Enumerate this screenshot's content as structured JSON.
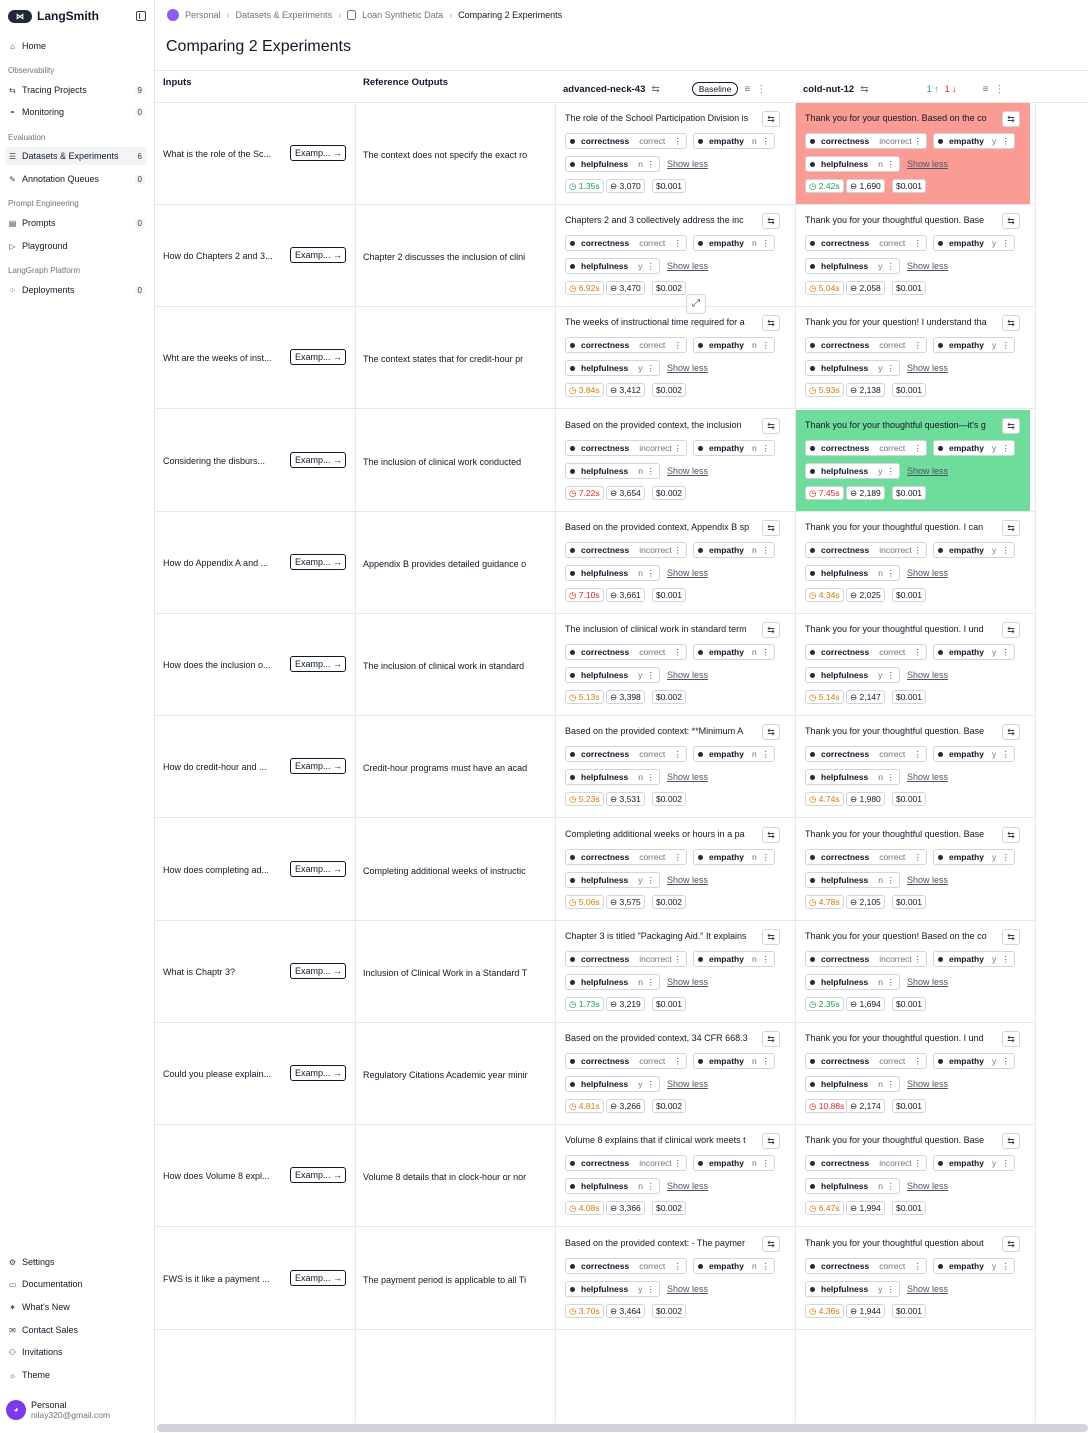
{
  "app": {
    "name": "LangSmith"
  },
  "sidebar": {
    "home": "Home",
    "sections": {
      "observability": "Observability",
      "evaluation": "Evaluation",
      "prompt_engineering": "Prompt Engineering",
      "langgraph": "LangGraph Platform"
    },
    "items": [
      {
        "label": "Tracing Projects",
        "count": "9"
      },
      {
        "label": "Monitoring",
        "count": "0"
      },
      {
        "label": "Datasets & Experiments",
        "count": "6"
      },
      {
        "label": "Annotation Queues",
        "count": "0"
      },
      {
        "label": "Prompts",
        "count": "0"
      },
      {
        "label": "Playground",
        "count": ""
      },
      {
        "label": "Deployments",
        "count": "0"
      }
    ],
    "bottom": [
      "Settings",
      "Documentation",
      "What's New",
      "Contact Sales",
      "Invitations",
      "Theme"
    ],
    "user": {
      "name": "Personal",
      "email": "nilay320@gmail.com"
    }
  },
  "breadcrumb": [
    "Personal",
    "Datasets & Experiments",
    "Loan Synthetic Data",
    "Comparing 2 Experiments"
  ],
  "page_title": "Comparing 2 Experiments",
  "columns": {
    "inputs": "Inputs",
    "reference": "Reference Outputs",
    "exp1": {
      "name": "advanced-neck-43",
      "badge": "Baseline"
    },
    "exp2": {
      "name": "cold-nut-12",
      "improved": "1",
      "regressed": "1"
    }
  },
  "example_label": "Examp...",
  "show_less": "Show less",
  "feedback_keys": {
    "correctness": "correctness",
    "empathy": "empathy",
    "helpfulness": "helpfulness"
  },
  "rows": [
    {
      "input": "What is the role of the Sc...",
      "ref": "The context does not specify the exact ro",
      "a": {
        "text": "The role of the School Participation Division is",
        "corr": "correct",
        "emp": "n",
        "help": "n",
        "lat": "1.35s",
        "latc": "g",
        "tok": "3,070",
        "cost": "$0.001"
      },
      "b": {
        "text": "Thank you for your question. Based on the co",
        "corr": "incorrect",
        "emp": "y",
        "help": "n",
        "lat": "2.42s",
        "latc": "g",
        "tok": "1,690",
        "cost": "$0.001",
        "hl": "red"
      }
    },
    {
      "input": "How do Chapters 2 and 3...",
      "ref": "Chapter 2 discusses the inclusion of clini",
      "a": {
        "text": "Chapters 2 and 3 collectively address the inc",
        "corr": "correct",
        "emp": "n",
        "help": "y",
        "lat": "6.92s",
        "latc": "o",
        "tok": "3,470",
        "cost": "$0.002"
      },
      "b": {
        "text": "Thank you for your thoughtful question. Base",
        "corr": "correct",
        "emp": "y",
        "help": "y",
        "lat": "5.04s",
        "latc": "o",
        "tok": "2,058",
        "cost": "$0.001"
      }
    },
    {
      "input": "Wht are the weeks of inst...",
      "ref": "The context states that for credit-hour pr",
      "a": {
        "text": "The weeks of instructional time required for a",
        "corr": "correct",
        "emp": "n",
        "help": "y",
        "lat": "3.84s",
        "latc": "o",
        "tok": "3,412",
        "cost": "$0.002"
      },
      "b": {
        "text": "Thank you for your question! I understand tha",
        "corr": "correct",
        "emp": "y",
        "help": "y",
        "lat": "5.93s",
        "latc": "o",
        "tok": "2,138",
        "cost": "$0.001"
      }
    },
    {
      "input": "Considering the disburs...",
      "ref": "The inclusion of clinical work conducted",
      "a": {
        "text": "Based on the provided context, the inclusion",
        "corr": "incorrect",
        "emp": "n",
        "help": "n",
        "lat": "7.22s",
        "latc": "r",
        "tok": "3,654",
        "cost": "$0.002"
      },
      "b": {
        "text": "Thank you for your thoughtful question—it's g",
        "corr": "correct",
        "emp": "y",
        "help": "y",
        "lat": "7.45s",
        "latc": "r",
        "tok": "2,189",
        "cost": "$0.001",
        "hl": "green"
      }
    },
    {
      "input": "How do Appendix A and ...",
      "ref": "Appendix B provides detailed guidance o",
      "a": {
        "text": "Based on the provided context, Appendix B sp",
        "corr": "incorrect",
        "emp": "n",
        "help": "n",
        "lat": "7.10s",
        "latc": "r",
        "tok": "3,661",
        "cost": "$0.001"
      },
      "b": {
        "text": "Thank you for your thoughtful question. I can",
        "corr": "incorrect",
        "emp": "y",
        "help": "n",
        "lat": "4.34s",
        "latc": "o",
        "tok": "2,025",
        "cost": "$0.001"
      }
    },
    {
      "input": "How does the inclusion o...",
      "ref": "The inclusion of clinical work in standard",
      "a": {
        "text": "The inclusion of clinical work in standard term",
        "corr": "correct",
        "emp": "n",
        "help": "y",
        "lat": "5.13s",
        "latc": "o",
        "tok": "3,398",
        "cost": "$0.002"
      },
      "b": {
        "text": "Thank you for your thoughtful question. I und",
        "corr": "correct",
        "emp": "y",
        "help": "y",
        "lat": "5.14s",
        "latc": "o",
        "tok": "2,147",
        "cost": "$0.001"
      }
    },
    {
      "input": "How do credit-hour and ...",
      "ref": "Credit-hour programs must have an acad",
      "a": {
        "text": "Based on the provided context: **Minimum A",
        "corr": "correct",
        "emp": "n",
        "help": "n",
        "lat": "5.23s",
        "latc": "o",
        "tok": "3,531",
        "cost": "$0.002"
      },
      "b": {
        "text": "Thank you for your thoughtful question. Base",
        "corr": "correct",
        "emp": "y",
        "help": "n",
        "lat": "4.74s",
        "latc": "o",
        "tok": "1,980",
        "cost": "$0.001"
      }
    },
    {
      "input": "How does completing ad...",
      "ref": "Completing additional weeks of instructic",
      "a": {
        "text": "Completing additional weeks or hours in a pa",
        "corr": "correct",
        "emp": "n",
        "help": "y",
        "lat": "5.06s",
        "latc": "o",
        "tok": "3,575",
        "cost": "$0.002"
      },
      "b": {
        "text": "Thank you for your thoughtful question. Base",
        "corr": "correct",
        "emp": "y",
        "help": "n",
        "lat": "4.78s",
        "latc": "o",
        "tok": "2,105",
        "cost": "$0.001"
      }
    },
    {
      "input": "What is Chaptr 3?",
      "ref": "Inclusion of Clinical Work in a Standard T",
      "a": {
        "text": "Chapter 3 is titled \"Packaging Aid.\" It explains",
        "corr": "incorrect",
        "emp": "n",
        "help": "n",
        "lat": "1.73s",
        "latc": "g",
        "tok": "3,219",
        "cost": "$0.001"
      },
      "b": {
        "text": "Thank you for your question! Based on the co",
        "corr": "incorrect",
        "emp": "y",
        "help": "n",
        "lat": "2.35s",
        "latc": "g",
        "tok": "1,694",
        "cost": "$0.001"
      }
    },
    {
      "input": "Could you please explain...",
      "ref": "Regulatory Citations Academic year minir",
      "a": {
        "text": "Based on the provided context, 34 CFR 668.3",
        "corr": "correct",
        "emp": "n",
        "help": "y",
        "lat": "4.81s",
        "latc": "o",
        "tok": "3,266",
        "cost": "$0.002"
      },
      "b": {
        "text": "Thank you for your thoughtful question. I und",
        "corr": "correct",
        "emp": "y",
        "help": "n",
        "lat": "10.88s",
        "latc": "r",
        "tok": "2,174",
        "cost": "$0.001"
      }
    },
    {
      "input": "How does Volume 8 expl...",
      "ref": "Volume 8 details that in clock-hour or nor",
      "a": {
        "text": "Volume 8 explains that if clinical work meets t",
        "corr": "incorrect",
        "emp": "n",
        "help": "n",
        "lat": "4.08s",
        "latc": "o",
        "tok": "3,366",
        "cost": "$0.002"
      },
      "b": {
        "text": "Thank you for your thoughtful question. Base",
        "corr": "incorrect",
        "emp": "y",
        "help": "n",
        "lat": "6.47s",
        "latc": "o",
        "tok": "1,994",
        "cost": "$0.001"
      }
    },
    {
      "input": "FWS is it like a payment ...",
      "ref": "The payment period is applicable to all Ti",
      "a": {
        "text": "Based on the provided context: - The paymer",
        "corr": "correct",
        "emp": "n",
        "help": "y",
        "lat": "3.70s",
        "latc": "o",
        "tok": "3,464",
        "cost": "$0.002"
      },
      "b": {
        "text": "Thank you for your thoughtful question about",
        "corr": "correct",
        "emp": "y",
        "help": "y",
        "lat": "4.36s",
        "latc": "o",
        "tok": "1,944",
        "cost": "$0.001"
      }
    }
  ],
  "colors": {
    "regression": "#fa9c93",
    "improvement": "#6edc9a",
    "latency_fast": "#16a34a",
    "latency_mid": "#d97706",
    "latency_slow": "#dc2626"
  }
}
